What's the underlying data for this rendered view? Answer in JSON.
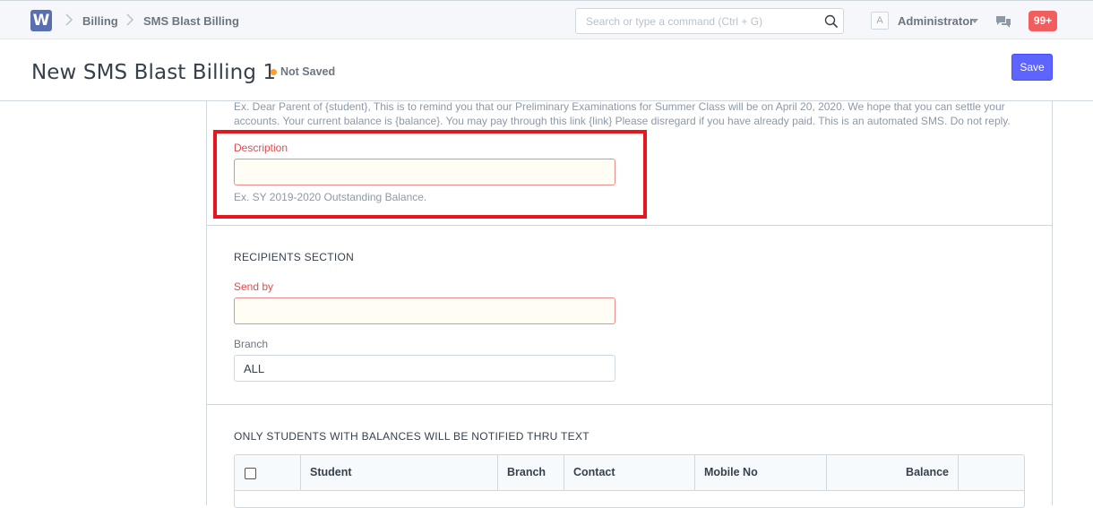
{
  "app": {
    "logo_letter": "W"
  },
  "breadcrumb": [
    "Billing",
    "SMS Blast Billing"
  ],
  "search": {
    "placeholder": "Search or type a command (Ctrl + G)"
  },
  "user": {
    "avatar_letter": "A",
    "name": "Administrator"
  },
  "notifications": {
    "count": "99+"
  },
  "page": {
    "title": "New SMS Blast Billing 1",
    "status": "Not Saved",
    "save_label": "Save"
  },
  "message_help": "Ex. Dear Parent of {student}, This is to remind you that our Preliminary Examinations for Summer Class will be on April 20, 2020. We hope that you can settle your accounts. Your current balance is {balance}. You may pay through this link {link} Please disregard if you have already paid. This is an automated SMS. Do not reply.",
  "description": {
    "label": "Description",
    "value": "",
    "help": "Ex. SY 2019-2020 Outstanding Balance."
  },
  "recipients": {
    "title": "RECIPIENTS SECTION",
    "send_by": {
      "label": "Send by",
      "value": ""
    },
    "branch": {
      "label": "Branch",
      "value": "ALL"
    }
  },
  "students": {
    "title": "ONLY STUDENTS WITH BALANCES WILL BE NOTIFIED THRU TEXT",
    "columns": [
      "Student",
      "Branch",
      "Contact",
      "Mobile No",
      "Balance"
    ]
  },
  "colors": {
    "primary": "#5e64ff",
    "error": "#e24c4c",
    "highlight": "#e6161f",
    "notification": "#f25e5e"
  }
}
